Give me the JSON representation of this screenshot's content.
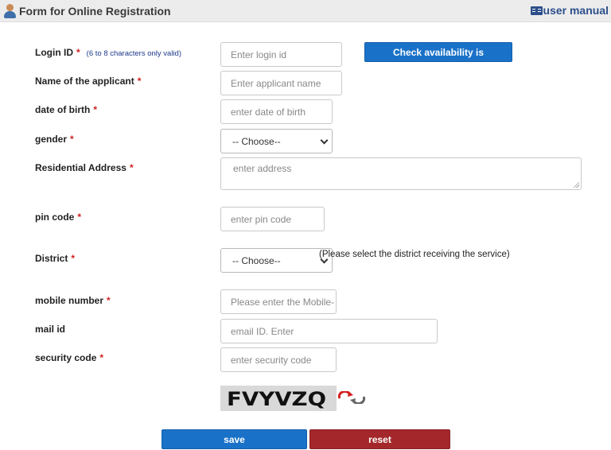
{
  "header": {
    "title": "Form for Online Registration",
    "user_manual": "user manual"
  },
  "form": {
    "login_id": {
      "label": "Login ID",
      "required": "*",
      "hint": "(6 to 8 characters only valid)",
      "placeholder": "Enter login id",
      "check_button": "Check availability is"
    },
    "applicant_name": {
      "label": "Name of the applicant",
      "required": "*",
      "placeholder": "Enter applicant name"
    },
    "dob": {
      "label": "date of birth",
      "required": "*",
      "placeholder": "enter date of birth"
    },
    "gender": {
      "label": "gender",
      "required": "*",
      "selected": "-- Choose--"
    },
    "address": {
      "label": "Residential Address",
      "required": "*",
      "placeholder": "enter address"
    },
    "pin_code": {
      "label": "pin code",
      "required": "*",
      "placeholder": "enter pin code"
    },
    "district": {
      "label": "District",
      "required": "*",
      "selected": "-- Choose--",
      "note": "(Please select the district receiving the service)"
    },
    "mobile": {
      "label": "mobile number",
      "required": "*",
      "placeholder": "Please enter the Mobile-"
    },
    "mail": {
      "label": "mail id",
      "placeholder": "email ID.  Enter"
    },
    "security": {
      "label": "security code",
      "required": "*",
      "placeholder": "enter security code",
      "captcha_text": "FVYVZQ"
    }
  },
  "actions": {
    "save": "save",
    "reset": "reset"
  },
  "colors": {
    "primary": "#1a72c8",
    "danger": "#a4282b",
    "required": "#d02020"
  }
}
